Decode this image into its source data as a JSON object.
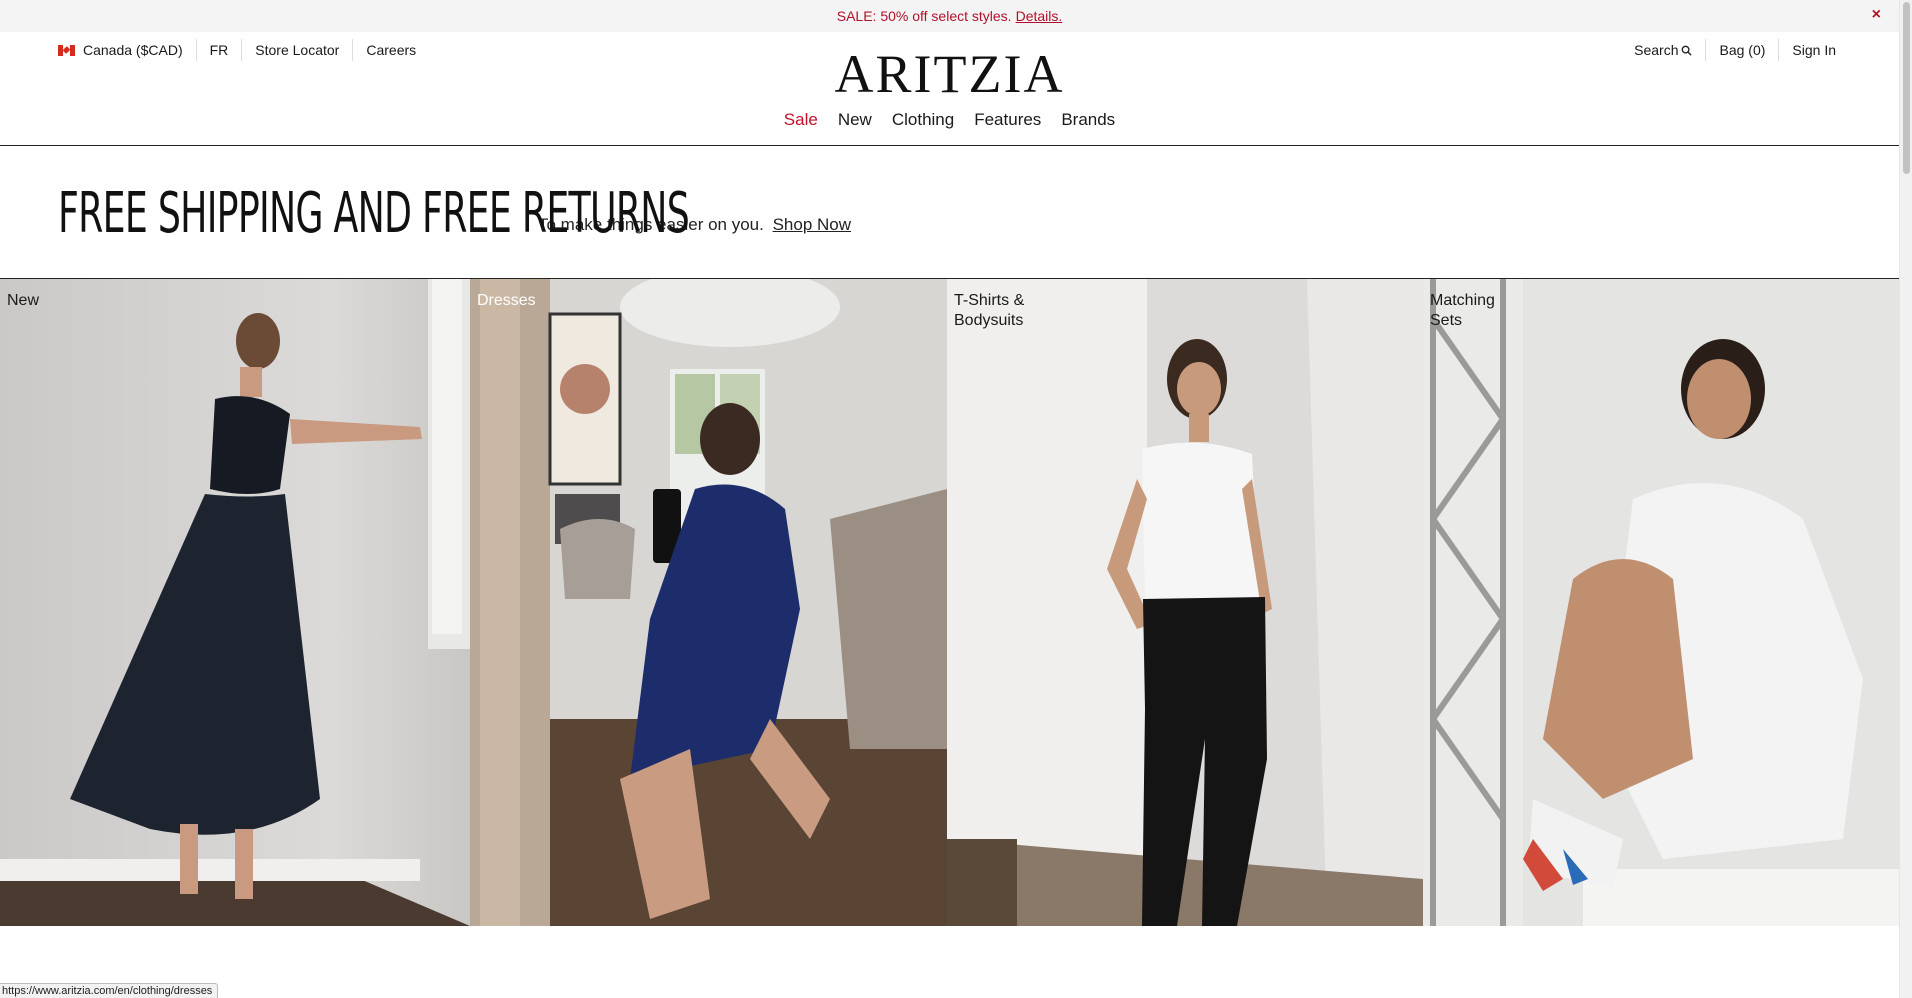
{
  "promo": {
    "text": "SALE: 50% off select styles.",
    "link": "Details.",
    "close_glyph": "×"
  },
  "utility_left": {
    "country": "Canada ($CAD)",
    "language": "FR",
    "store_locator": "Store Locator",
    "careers": "Careers"
  },
  "utility_right": {
    "search": "Search",
    "bag": "Bag (0)",
    "sign_in": "Sign In"
  },
  "logo": "ARITZIA",
  "nav": {
    "sale": "Sale",
    "new": "New",
    "clothing": "Clothing",
    "features": "Features",
    "brands": "Brands"
  },
  "banner": {
    "headline": "FREE SHIPPING AND FREE RETURNS",
    "subtext": "To make things easier on you.",
    "cta": "Shop Now"
  },
  "tiles": [
    {
      "label": "New",
      "label_color": "#1a1a1a"
    },
    {
      "label": "Dresses",
      "label_color": "#ffffff"
    },
    {
      "label": "T-Shirts & Bodysuits",
      "label_color": "#1a1a1a"
    },
    {
      "label": "Matching Sets",
      "label_color": "#1a1a1a"
    }
  ],
  "status_url": "https://www.aritzia.com/en/clothing/dresses",
  "colors": {
    "sale_red": "#c2102a",
    "promo_bg": "#f4f4f4"
  }
}
